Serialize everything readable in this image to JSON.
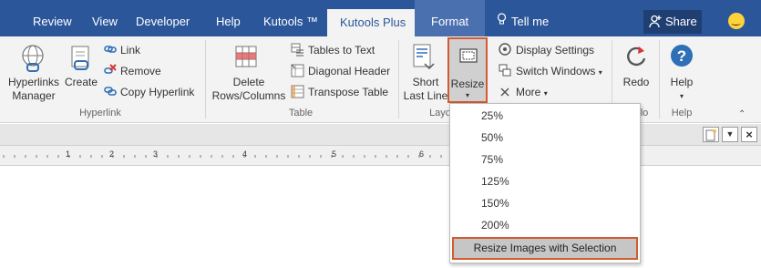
{
  "tabs": [
    "Review",
    "View",
    "Developer",
    "Help",
    "Kutools ™",
    "Kutools Plus",
    "Format"
  ],
  "tell_me": "Tell me",
  "share": "Share",
  "hyperlink_group": {
    "hyperlinks_manager_line1": "Hyperlinks",
    "hyperlinks_manager_line2": "Manager",
    "create": "Create",
    "link": "Link",
    "remove": "Remove",
    "copy_hyperlink": "Copy Hyperlink",
    "group_label": "Hyperlink"
  },
  "table_group": {
    "delete_line1": "Delete",
    "delete_line2": "Rows/Columns",
    "tables_to_text": "Tables to Text",
    "diagonal_header": "Diagonal Header",
    "transpose_table": "Transpose Table",
    "group_label": "Table"
  },
  "layout_group": {
    "short_line1": "Short",
    "short_line2": "Last Line",
    "resize": "Resize",
    "display_settings": "Display Settings",
    "switch_windows": "Switch Windows",
    "more": "More",
    "group_label_partial": "Layo"
  },
  "redo": "Redo",
  "help_button": "Help",
  "help_group_label": "Help",
  "redo_group_label_partial": "lo",
  "ruler_numbers": [
    "1",
    "2",
    "3",
    "4",
    "5",
    "6"
  ],
  "dropdown_items": [
    "25%",
    "50%",
    "75%",
    "125%",
    "150%",
    "200%"
  ],
  "dropdown_action": "Resize Images with Selection",
  "colors": {
    "ribbon_blue": "#2b579a",
    "highlight": "#d45a30"
  }
}
